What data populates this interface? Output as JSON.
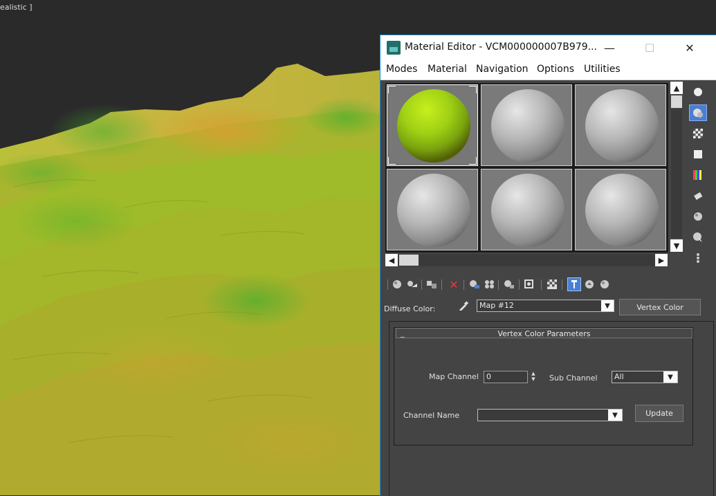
{
  "viewport": {
    "label": "ealistic ]"
  },
  "window": {
    "title": "Material Editor - VCM000000007B979...",
    "minimize": "—",
    "maximize": "☐",
    "close": "✕"
  },
  "menu": [
    "Modes",
    "Material",
    "Navigation",
    "Options",
    "Utilities"
  ],
  "slots": {
    "active_color": "#9fd014",
    "default_color": "#b7b7b7"
  },
  "scroll": {
    "up": "▲",
    "down": "▼",
    "left": "◀",
    "right": "▶"
  },
  "diffuse": {
    "label": "Diffuse Color:",
    "map_value": "Map #12",
    "map_type_button": "Vertex Color"
  },
  "rollout": {
    "collapse_symbol": "_",
    "title": "Vertex Color Parameters",
    "map_channel_label": "Map Channel",
    "map_channel_value": "0",
    "sub_channel_label": "Sub Channel",
    "sub_channel_value": "All",
    "channel_name_label": "Channel Name",
    "channel_name_value": "",
    "update_button": "Update"
  },
  "icons": {
    "app": "3ds-max-icon",
    "eyedropper": "eyedropper-icon"
  }
}
